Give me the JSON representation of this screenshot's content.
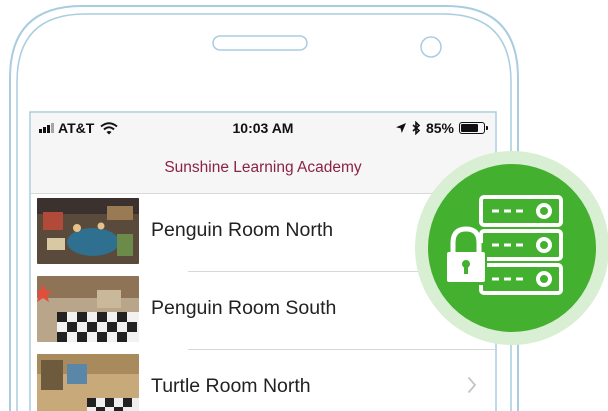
{
  "status_bar": {
    "carrier": "AT&T",
    "time": "10:03 AM",
    "battery_percent": "85%",
    "battery_level": 0.85
  },
  "nav": {
    "title": "Sunshine Learning Academy"
  },
  "rooms": [
    {
      "name": "Penguin Room North"
    },
    {
      "name": "Penguin Room South"
    },
    {
      "name": "Turtle Room North"
    }
  ],
  "icons": {
    "badge": "secure-server-lock-icon",
    "row_disclosure": "chevron-right-icon"
  },
  "colors": {
    "title": "#8b2248",
    "badge_green": "#44b02f",
    "badge_ring": "#d9efd3"
  }
}
